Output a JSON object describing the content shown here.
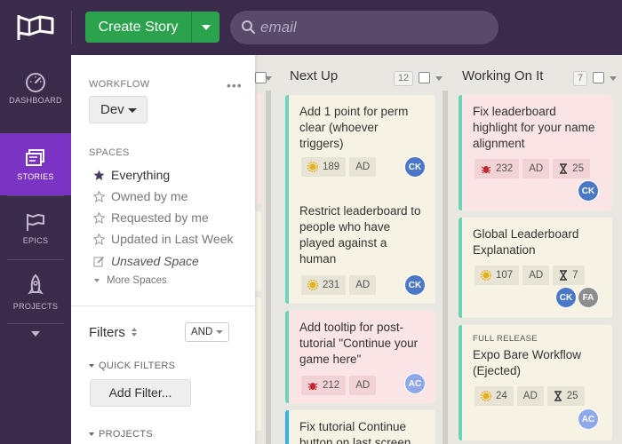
{
  "topbar": {
    "create_label": "Create Story",
    "search_placeholder": "email"
  },
  "leftnav": {
    "items": [
      {
        "label": "DASHBOARD",
        "icon": "gauge-icon"
      },
      {
        "label": "STORIES",
        "icon": "stories-icon",
        "active": true
      },
      {
        "label": "EPICS",
        "icon": "flag-icon"
      },
      {
        "label": "PROJECTS",
        "icon": "rocket-icon"
      }
    ]
  },
  "panel": {
    "workflow_label": "WORKFLOW",
    "workflow_value": "Dev",
    "spaces_label": "SPACES",
    "spaces": [
      {
        "label": "Everything",
        "active": true
      },
      {
        "label": "Owned by me"
      },
      {
        "label": "Requested by me"
      },
      {
        "label": "Updated in Last Week"
      },
      {
        "label": "Unsaved Space"
      }
    ],
    "more_spaces": "More Spaces",
    "filters_title": "Filters",
    "and_value": "AND",
    "quick_filters_label": "QUICK FILTERS",
    "add_filter_label": "Add Filter...",
    "projects_label": "PROJECTS"
  },
  "columns": [
    {
      "title": "Next Up",
      "count": "12",
      "cards": [
        {
          "title": "Add 1 point for perm clear (whoever triggers)",
          "type": "feature",
          "points": "189",
          "owner_chip": "AD",
          "avatars": [
            "CK"
          ]
        },
        {
          "title": "Restrict leaderboard to people who have played against a human",
          "type": "feature",
          "points": "231",
          "owner_chip": "AD",
          "avatars": [
            "CK"
          ]
        },
        {
          "title": "Add tooltip for post-tutorial \"Continue your game here\"",
          "type": "bug",
          "points": "212",
          "owner_chip": "AD",
          "avatars": [
            "AC"
          ]
        },
        {
          "title": "Fix tutorial Continue button on last screen",
          "type": "feature"
        }
      ]
    },
    {
      "title": "Working On It",
      "count": "7",
      "cards": [
        {
          "title": "Fix leaderboard highlight for your name alignment",
          "type": "bug",
          "points": "232",
          "owner_chip": "AD",
          "estimate": "25",
          "avatars": [
            "CK"
          ]
        },
        {
          "title": "Global Leaderboard Explanation",
          "type": "feature",
          "points": "107",
          "owner_chip": "AD",
          "estimate": "7",
          "avatars": [
            "CK",
            "FA"
          ]
        },
        {
          "epic": "FULL RELEASE",
          "title": "Expo Bare Workflow (Ejected)",
          "type": "feature",
          "points": "24",
          "owner_chip": "AD",
          "estimate": "25",
          "avatars": [
            "AC"
          ]
        }
      ]
    }
  ],
  "colors": {
    "topbar": "#3a2b4b",
    "active_nav": "#7b33c4",
    "create_green": "#2aa34c",
    "card_yellow": "#f6f3e4",
    "card_pink": "#fae4e5",
    "card_edge": "#6ad3b8",
    "avatar_blue": "#4a78c6",
    "avatar_gray": "#8e8e8e",
    "avatar_light": "#8fa8ea"
  }
}
